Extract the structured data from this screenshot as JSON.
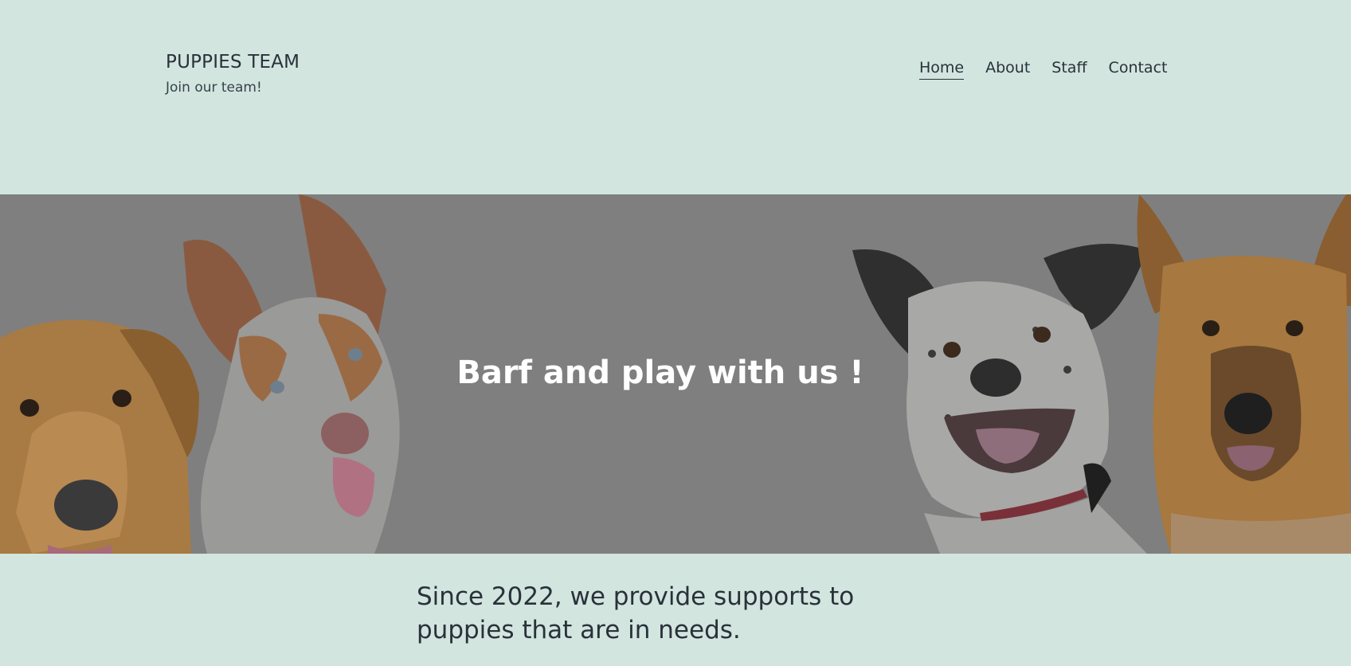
{
  "header": {
    "site_title": "PUPPIES TEAM",
    "tagline": "Join our team!",
    "nav": [
      {
        "label": "Home",
        "current": true
      },
      {
        "label": "About",
        "current": false
      },
      {
        "label": "Staff",
        "current": false
      },
      {
        "label": "Contact",
        "current": false
      }
    ]
  },
  "hero": {
    "heading": "Barf and play with us !",
    "overlay_color": "#7f7f7f"
  },
  "intro": {
    "text": "Since 2022, we provide supports to puppies that are in needs."
  },
  "colors": {
    "background": "#d2e5df",
    "text": "#29313a",
    "hero_text": "#ffffff"
  }
}
